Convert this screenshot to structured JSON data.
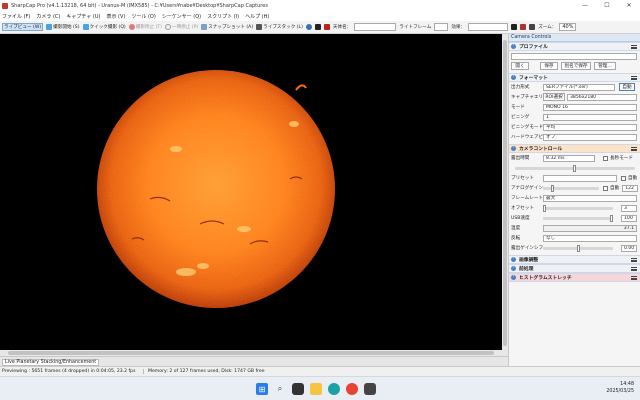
{
  "window": {
    "title": "SharpCap Pro (v4.1.13218, 64 bit) - Uranus-M (IMX585) - C:¥Users¥nabe¥Desktop¥SharpCap Captures",
    "minimize": "—",
    "maximize": "☐",
    "close": "✕"
  },
  "menu": [
    "ファイル (F)",
    "カメラ (C)",
    "キャプチャ (U)",
    "表示 (V)",
    "ツール (O)",
    "シーケンサー (Q)",
    "スクリプト (I)",
    "ヘルプ (H)"
  ],
  "toolbar": {
    "live_view": "ライブビュー (W)",
    "start_capture": "撮影開始 (S)",
    "quick_capture": "クイック撮影 (Q)",
    "stop_capture": "撮影停止 (T)",
    "pause": "一時停止 (P)",
    "snapshot": "スナップショット (A)",
    "live_stack": "ライブスタック (L)",
    "target_name": "天体名：",
    "light_frame": "ライトフレーム",
    "effect": "効果：",
    "zoom_label": "ズーム：",
    "zoom_value": "40%"
  },
  "colors": {
    "accent": "#4a7fc1",
    "sun_core": "#ff8a1e",
    "sun_edge": "#c63b04",
    "background": "#000000"
  },
  "panel": {
    "title": "Camera Controls",
    "profile": {
      "header": "プロファイル",
      "buttons": [
        "開く",
        "保存",
        "別名で保存",
        "管理..."
      ]
    },
    "format": {
      "header": "フォーマット",
      "output_format_label": "出力形式",
      "output_format_value": "SERファイル(*.ser)",
      "auto_button": "自動",
      "capture_area_label": "キャプチャエリア",
      "roi_button": "ROI選択",
      "capture_area_value": "3856x2180",
      "mode_label": "モード",
      "mode_value": "MONO 16",
      "binning_label": "ビニング",
      "binning_value": "1",
      "binning_mode_label": "ビニングモード",
      "binning_mode_value": "平均",
      "hw_binning_label": "ハードウェアビニング",
      "hw_binning_value": "オフ"
    },
    "camera": {
      "header": "カメラコントロール",
      "exposure_label": "露出時間",
      "exposure_value": "8.32 ms",
      "long_exposure": "長秒モード",
      "preset_label": "プリセット",
      "auto": "自動",
      "analog_gain_label": "アナログゲイン",
      "analog_gain_auto": "自動",
      "analog_gain_value": "122",
      "frame_rate_label": "フレームレート",
      "frame_rate_value": "最大",
      "offset_label": "オフセット",
      "offset_value": "3",
      "usb_speed_label": "USB速度",
      "usb_speed_value": "100",
      "temperature_label": "温度",
      "temperature_value": "37.1",
      "flip_label": "反転",
      "flip_value": "なし",
      "digital_gain_label": "露出ゲインシフト",
      "digital_gain_value": "0.00"
    },
    "image_adjust": "画像調整",
    "preprocess": "前処理",
    "histogram": "ヒストグラムストレッチ"
  },
  "bottom_tab": "Live Planetary Stacking/Enhancement",
  "status": {
    "preview": "Previewing : 5651 frames (4 dropped) in 0:04:05, 23.2 fps",
    "memory": "Memory: 2 of 127 frames used, Disk: 1747 GB free"
  },
  "clock": {
    "time": "14:48",
    "date": "2025/03/25"
  },
  "taskbar_icons": [
    "windows-start-icon",
    "search-icon",
    "task-view-icon",
    "file-explorer-icon",
    "edge-icon",
    "chrome-icon",
    "sharpcap-icon"
  ]
}
